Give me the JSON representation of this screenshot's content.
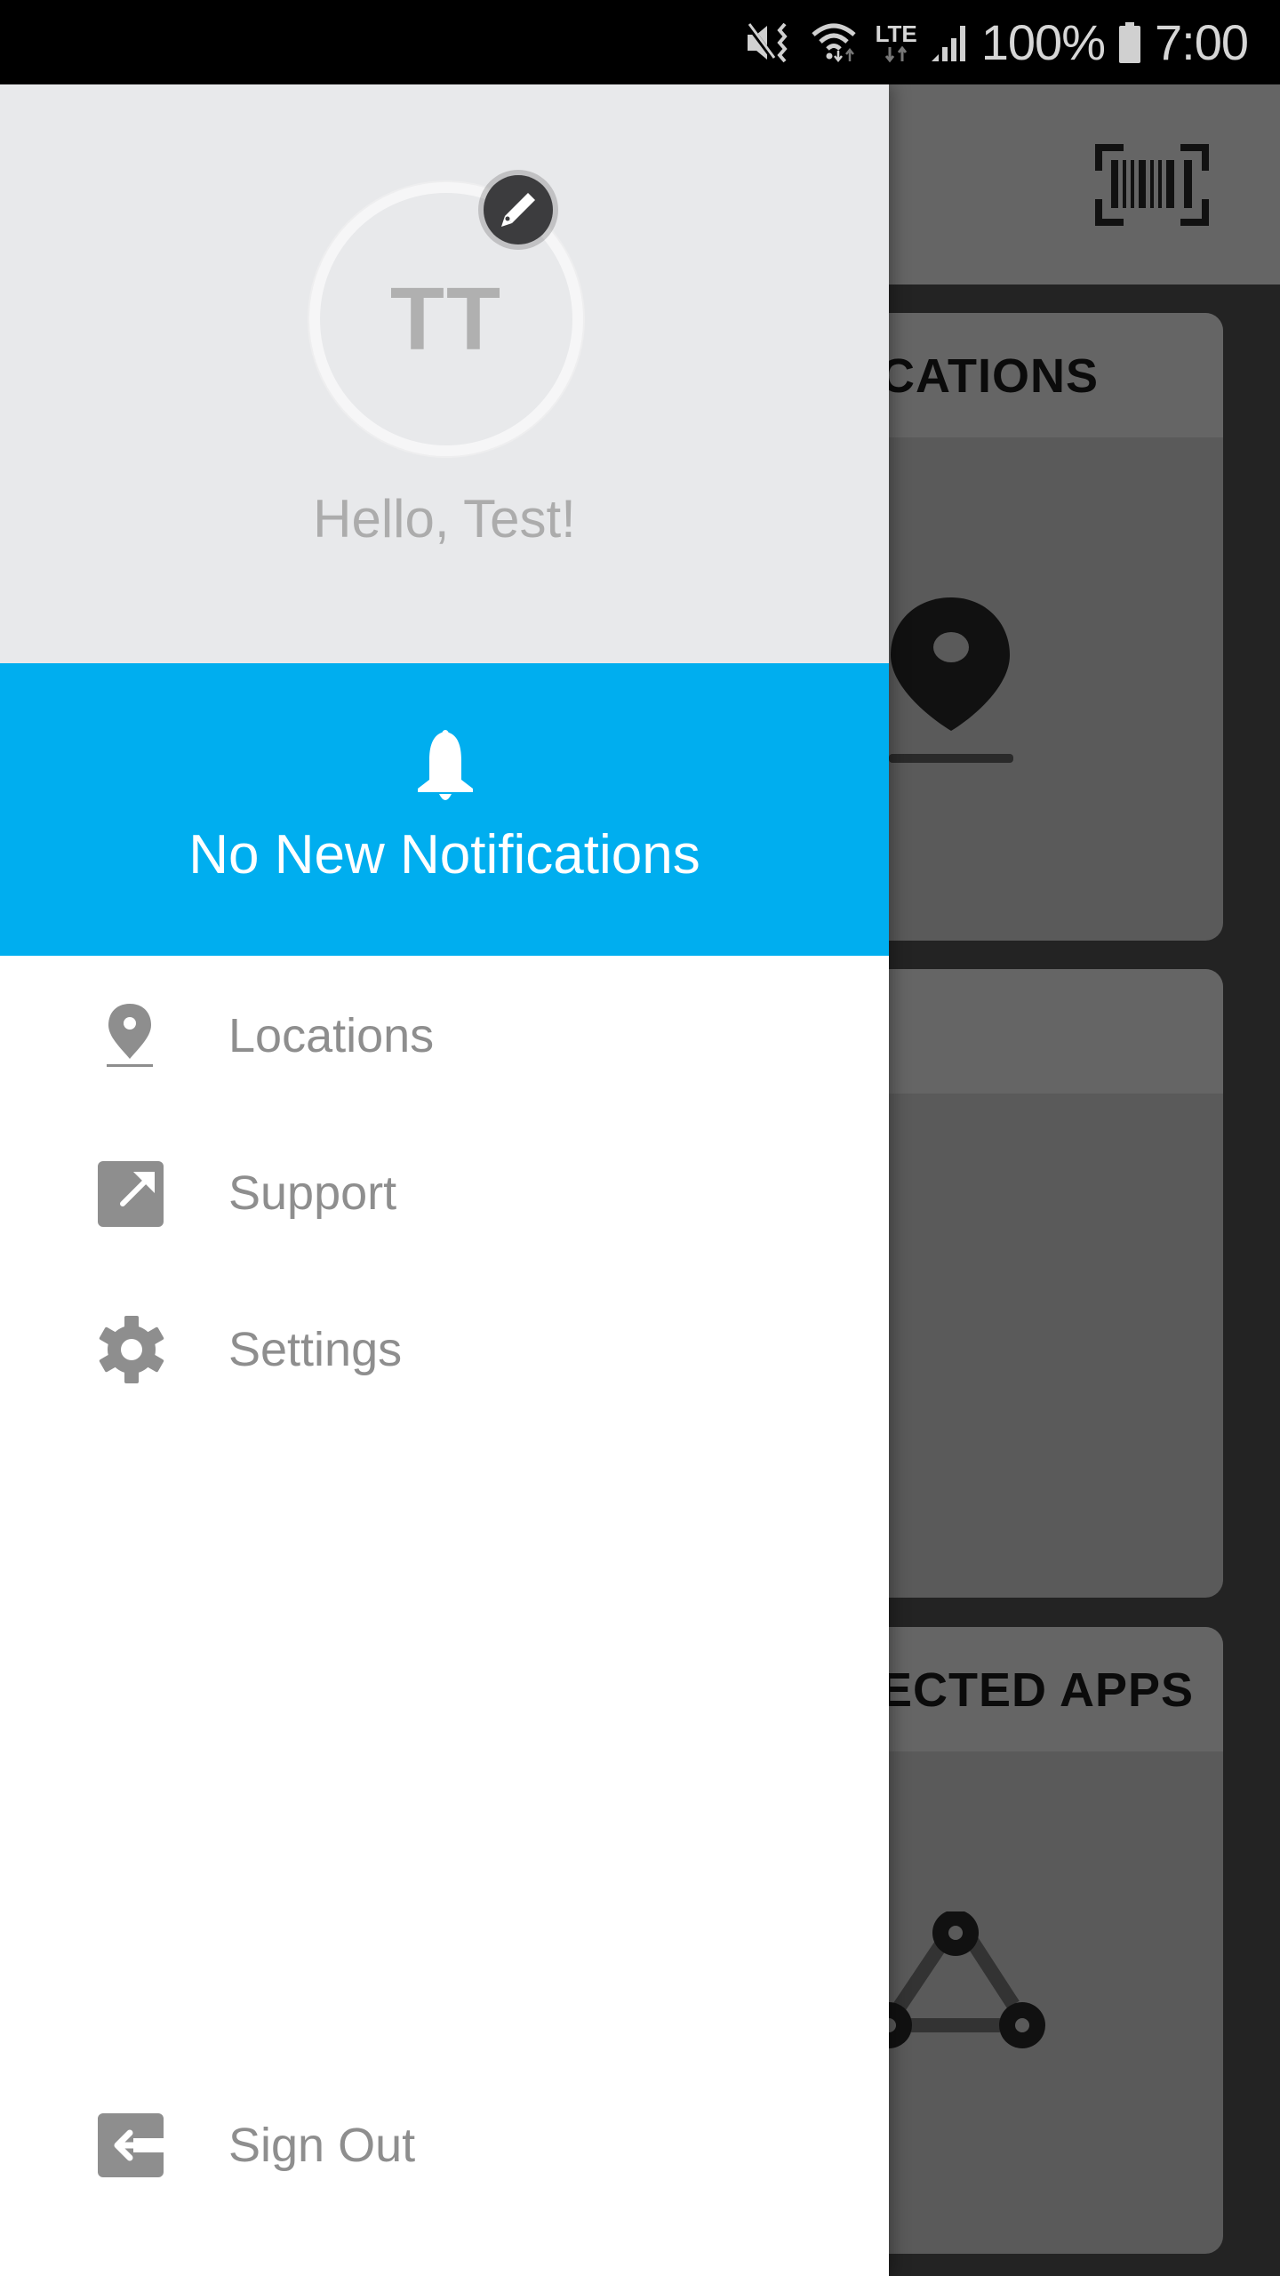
{
  "status_bar": {
    "icons": [
      "mute-vibrate-icon",
      "wifi-icon",
      "lte-icon",
      "signal-icon",
      "battery-icon"
    ],
    "network_label": "LTE",
    "battery_percent": "100%",
    "time": "7:00"
  },
  "drawer": {
    "avatar_initials": "TT",
    "greeting": "Hello, Test!",
    "notifications": {
      "icon": "bell-icon",
      "text": "No New Notifications",
      "background": "#00aeef"
    },
    "menu": [
      {
        "label": "Locations",
        "icon": "map-pin-icon"
      },
      {
        "label": "Support",
        "icon": "external-link-icon"
      },
      {
        "label": "Settings",
        "icon": "gear-icon"
      }
    ],
    "sign_out": {
      "label": "Sign Out",
      "icon": "sign-out-icon"
    }
  },
  "background_app": {
    "toolbar_icon": "barcode-scan-icon",
    "cards": [
      {
        "title_visible": "CATIONS",
        "icon": "map-pin-icon"
      },
      {
        "title_visible": "",
        "icon": ""
      },
      {
        "title_visible": "ECTED APPS",
        "icon": "connected-nodes-icon"
      }
    ]
  },
  "colors": {
    "accent": "#00aeef",
    "header_bg": "#e8e9eb",
    "menu_text": "#8e8e8e"
  }
}
